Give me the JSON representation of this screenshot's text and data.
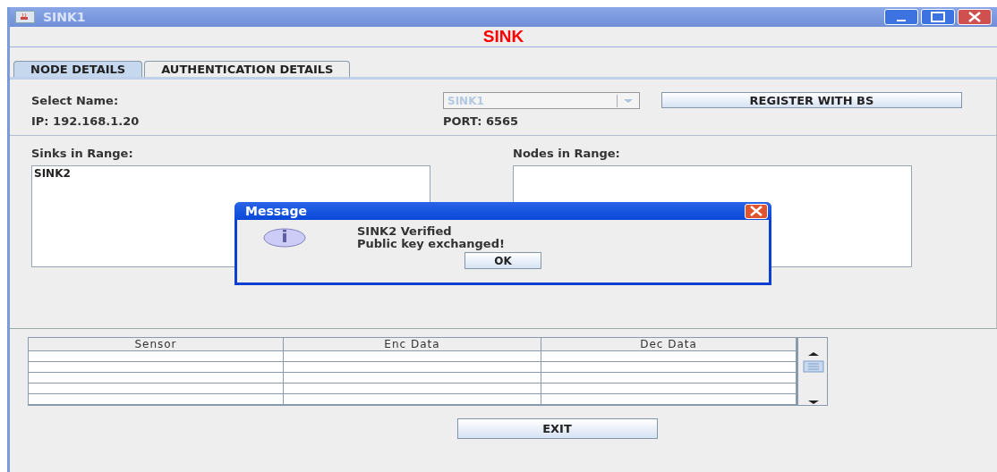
{
  "window": {
    "title": "SINK1"
  },
  "heading": "SINK",
  "tabs": [
    {
      "label": "NODE DETAILS",
      "selected": true
    },
    {
      "label": "AUTHENTICATION DETAILS",
      "selected": false
    }
  ],
  "node_details": {
    "select_name_label": "Select Name:",
    "select_name": {
      "value": "SINK1",
      "disabled": true
    },
    "register_button": "REGISTER WITH BS",
    "ip": "IP: 192.168.1.20",
    "port": "PORT: 6565",
    "sinks_label": "Sinks in Range:",
    "sinks": [
      "SINK2"
    ],
    "nodes_label": "Nodes in Range:"
  },
  "table": {
    "columns": [
      "Sensor",
      "Enc Data",
      "Dec Data"
    ]
  },
  "exit_button": "EXIT",
  "dialog": {
    "title": "Message",
    "lines": [
      "SINK2 Verified",
      "Public key exchanged!"
    ],
    "ok_button": "OK"
  }
}
